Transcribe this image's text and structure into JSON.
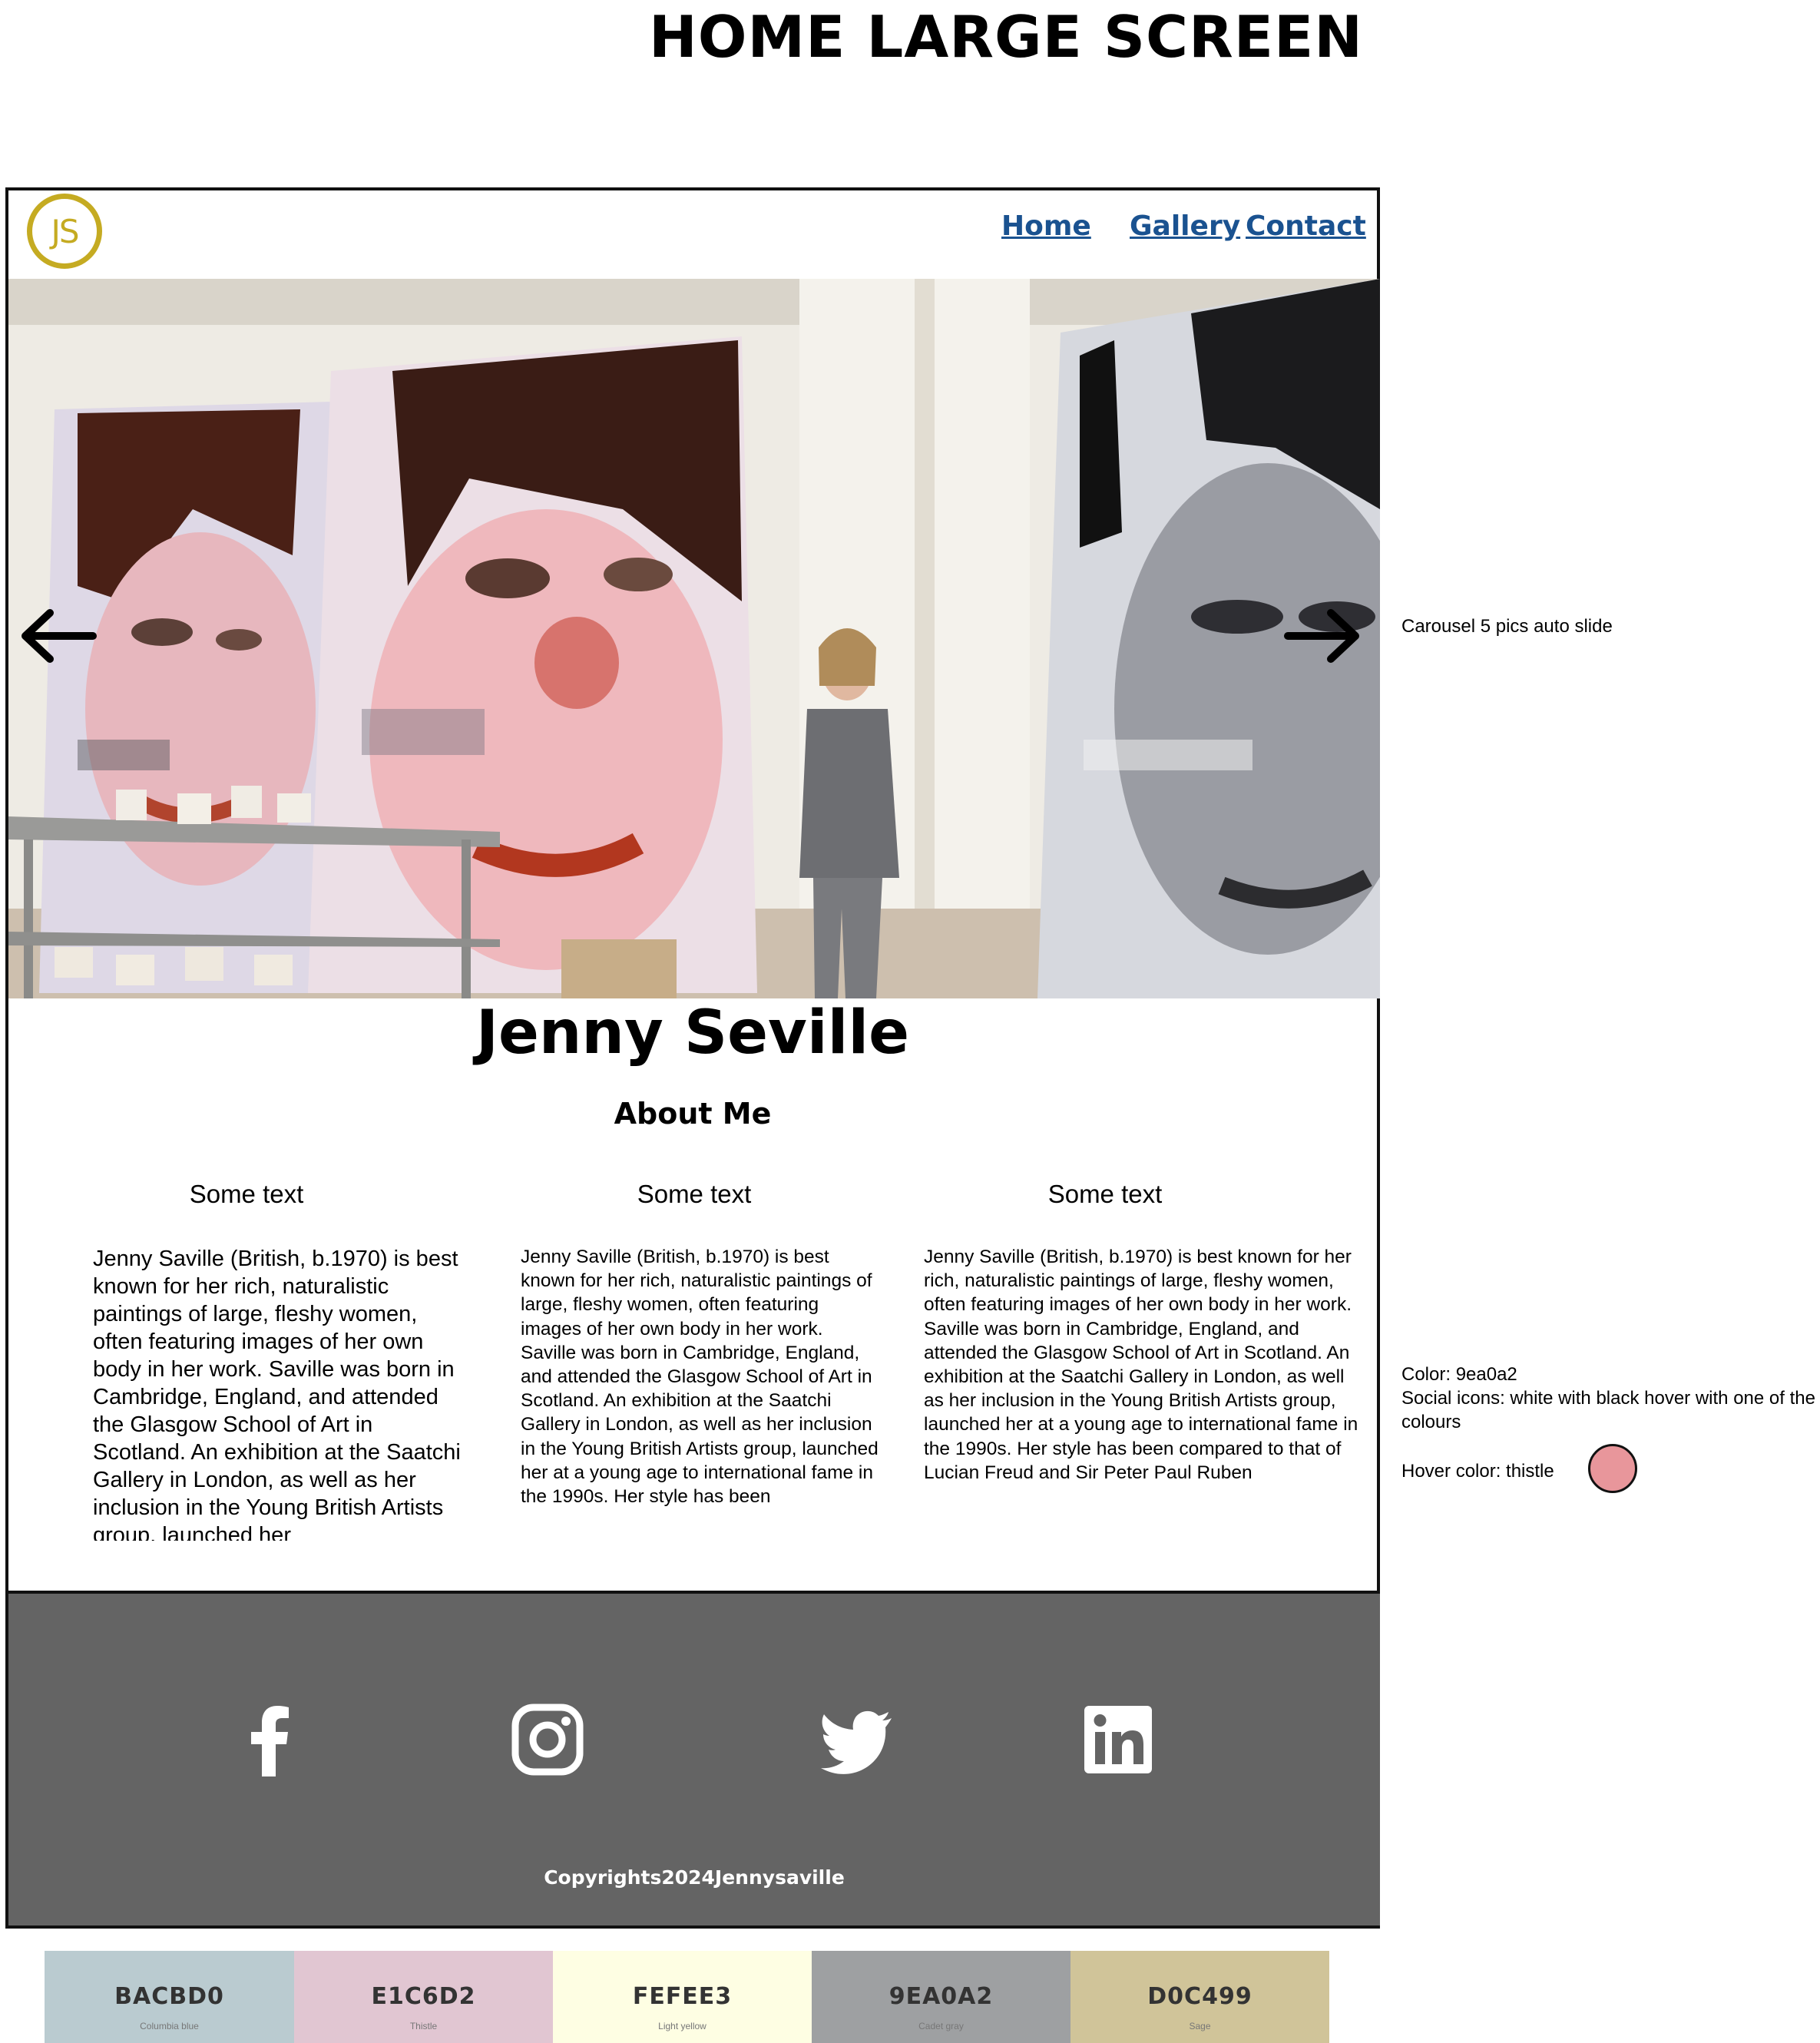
{
  "page": {
    "title": "HOME LARGE SCREEN"
  },
  "nav": {
    "logo_text": "JS",
    "links": [
      "Home",
      "Gallery",
      "Contact"
    ]
  },
  "hero": {
    "carousel_note": "Carousel 5 pics auto slide",
    "prev_icon": "arrow-left-icon",
    "next_icon": "arrow-right-icon"
  },
  "main": {
    "name": "Jenny Seville",
    "about_heading": "About Me",
    "columns": [
      {
        "heading": "Some text",
        "body": "Jenny Saville (British, b.1970) is best known for her rich, naturalistic paintings of large, fleshy women, often featuring images of her own body in her work. Saville was born in Cambridge, England, and attended the Glasgow School of Art in Scotland. An exhibition at the Saatchi Gallery in London, as well as her inclusion in the Young British Artists group, launched her"
      },
      {
        "heading": "Some text",
        "body": "Jenny Saville (British, b.1970) is best known for her rich, naturalistic paintings of large, fleshy women, often featuring images of her own body in her work. Saville was born in Cambridge, England, and attended the Glasgow School of Art in Scotland. An exhibition at the Saatchi Gallery in London, as well as her inclusion in the Young British Artists group, launched her at a young age to international fame in the 1990s. Her style has been"
      },
      {
        "heading": "Some text",
        "body": "Jenny Saville (British, b.1970) is best known for her rich, naturalistic paintings of large, fleshy women, often featuring images of her own body in her work. Saville was born in Cambridge, England, and attended the Glasgow School of Art in Scotland. An exhibition at the Saatchi Gallery in London, as well as her inclusion in the Young British Artists group, launched her at a young age to international fame in the 1990s. Her style has been compared to that of Lucian Freud and Sir Peter Paul Ruben"
      }
    ]
  },
  "footer": {
    "social_icons": [
      "facebook-icon",
      "instagram-icon",
      "twitter-icon",
      "linkedin-icon"
    ],
    "copyright": "Copyrights2024Jennysaville",
    "background_color": "#9ea0a2"
  },
  "annotations": {
    "color_line": "Color: 9ea0a2",
    "social_line": "Social icons: white with black hover with one of the colours",
    "hover_line": "Hover color: thistle",
    "hover_swatch_color": "#e8969b"
  },
  "palette": [
    {
      "hex": "BACBD0",
      "name": "Columbia blue",
      "color": "#bacbd0"
    },
    {
      "hex": "E1C6D2",
      "name": "Thistle",
      "color": "#e1c6d2"
    },
    {
      "hex": "FEFEE3",
      "name": "Light yellow",
      "color": "#fefee3"
    },
    {
      "hex": "9EA0A2",
      "name": "Cadet gray",
      "color": "#9ea0a2"
    },
    {
      "hex": "D0C499",
      "name": "Sage",
      "color": "#d0c499"
    }
  ]
}
